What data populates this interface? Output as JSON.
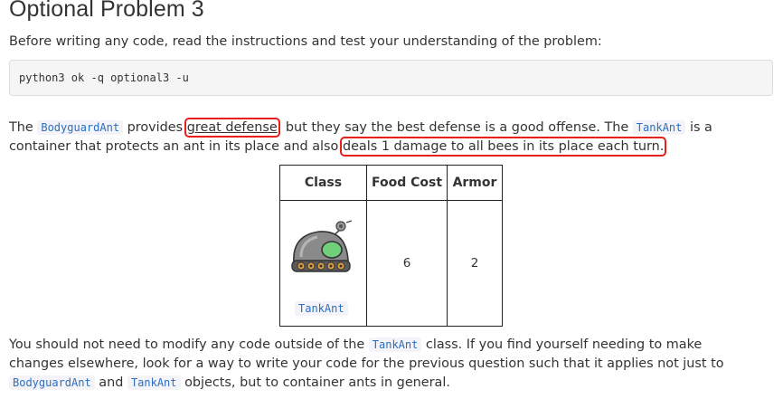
{
  "heading": "Optional Problem 3",
  "intro": "Before writing any code, read the instructions and test your understanding of the problem:",
  "command": "python3 ok -q optional3 -u",
  "para1": {
    "t1": "The ",
    "code1": "BodyguardAnt",
    "t2": " provides ",
    "hl1": "great defense",
    "t3": ", but they say the best defense is a good offense. The ",
    "code2": "TankAnt",
    "t4": " is a",
    "t5": "container that protects an ant in its place and also ",
    "hl2": "deals 1 damage to all bees in its place each turn."
  },
  "table": {
    "headers": [
      "Class",
      "Food Cost",
      "Armor"
    ],
    "row": {
      "class_label": "TankAnt",
      "food_cost": "6",
      "armor": "2"
    }
  },
  "para2": {
    "t1": "You should not need to modify any code outside of the ",
    "code1": "TankAnt",
    "t2": " class. If you find yourself needing to make",
    "t3": "changes elsewhere, look for a way to write your code for the previous question such that it applies not just to",
    "code2": "BodyguardAnt",
    "t4": " and ",
    "code3": "TankAnt",
    "t5": " objects, but to container ants in general."
  },
  "colors": {
    "highlight_box": "#e8201c",
    "inline_code": "#2b6fbf",
    "tank_body": "#8a8a8a",
    "tank_window": "#6fcf7a"
  },
  "icons": {
    "tank": "tank-ant-icon"
  }
}
